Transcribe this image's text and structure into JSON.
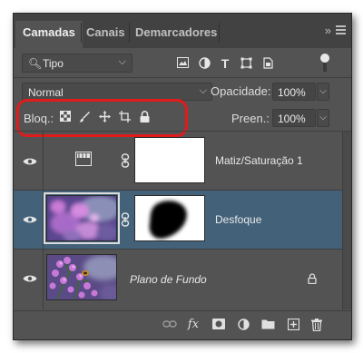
{
  "tabs": [
    {
      "label": "Camadas",
      "active": true
    },
    {
      "label": "Canais",
      "active": false
    },
    {
      "label": "Demarcadores",
      "active": false
    }
  ],
  "tab_controls": {
    "more": "»",
    "menu_icon": "panel-menu-icon"
  },
  "filter": {
    "value": "Tipo",
    "icons": [
      "image-filter-icon",
      "adjustment-filter-icon",
      "type-filter-icon",
      "shape-filter-icon",
      "smart-object-filter-icon"
    ]
  },
  "blend": {
    "mode": "Normal",
    "opacity_label": "Opacidade:",
    "opacity_value": "100%",
    "lock_label": "Bloq.:",
    "fill_label": "Preen.:",
    "fill_value": "100%",
    "lock_icons": [
      "lock-transparent-icon",
      "lock-pixels-icon",
      "lock-position-icon",
      "lock-artboard-icon",
      "lock-all-icon"
    ]
  },
  "layers": [
    {
      "name": "Matiz/Saturação 1",
      "type": "adjustment",
      "selected": false,
      "italic": false
    },
    {
      "name": "Desfoque",
      "type": "pixel-with-mask",
      "selected": true,
      "italic": false
    },
    {
      "name": "Plano de Fundo",
      "type": "background",
      "selected": false,
      "italic": true,
      "locked": true
    }
  ],
  "footer_icons": [
    "link-layers-icon",
    "fx-icon",
    "add-mask-icon",
    "new-fill-adjustment-icon",
    "new-group-icon",
    "new-layer-icon",
    "delete-icon"
  ],
  "colors": {
    "panel": "#535353",
    "tabbar": "#424242",
    "selected": "#43627a",
    "highlight": "#e11b1b"
  }
}
